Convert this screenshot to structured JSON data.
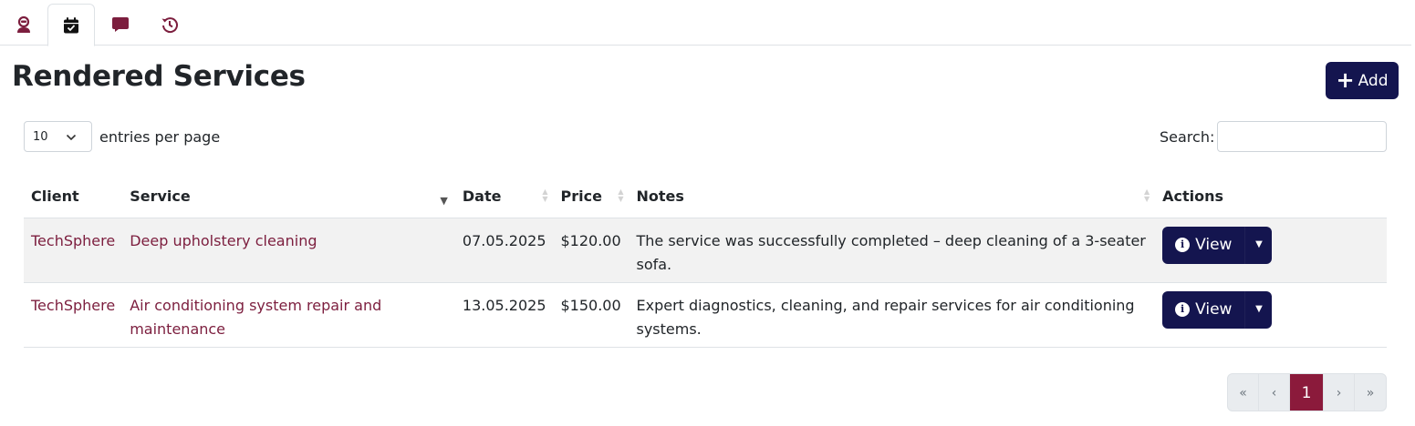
{
  "tabs": [
    {
      "id": "profile",
      "icon": "user-icon",
      "active": false
    },
    {
      "id": "calendar",
      "icon": "calendar-check-icon",
      "active": true
    },
    {
      "id": "messages",
      "icon": "chat-icon",
      "active": false
    },
    {
      "id": "history",
      "icon": "history-icon",
      "active": false
    }
  ],
  "page": {
    "title": "Rendered Services",
    "add_label": "Add"
  },
  "controls": {
    "entries_value": "10",
    "entries_label": "entries per page",
    "search_label": "Search:",
    "search_value": ""
  },
  "table": {
    "headers": {
      "client": "Client",
      "service": "Service",
      "date": "Date",
      "price": "Price",
      "notes": "Notes",
      "actions": "Actions"
    },
    "rows": [
      {
        "client": "TechSphere",
        "service": "Deep upholstery cleaning",
        "date": "07.05.2025",
        "price": "$120.00",
        "notes": "The service was successfully completed – deep cleaning of a 3-seater sofa.",
        "action_label": "View"
      },
      {
        "client": "TechSphere",
        "service": "Air conditioning system repair and maintenance",
        "date": "13.05.2025",
        "price": "$150.00",
        "notes": "Expert diagnostics, cleaning, and repair services for air conditioning systems.",
        "action_label": "View"
      }
    ]
  },
  "pagination": {
    "first": "«",
    "prev": "‹",
    "current": "1",
    "next": "›",
    "last": "»"
  },
  "colors": {
    "primary": "#14154f",
    "accent": "#8b1a3b",
    "link": "#7c1e3e"
  }
}
